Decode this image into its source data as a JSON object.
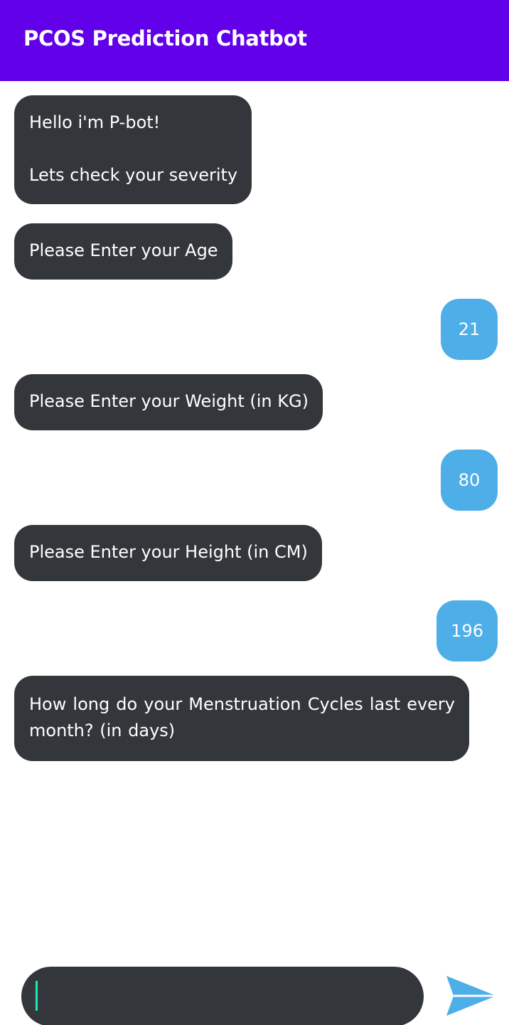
{
  "header": {
    "title": "PCOS Prediction Chatbot",
    "background": "#6200ea"
  },
  "colors": {
    "bot_bubble": "#33363a",
    "user_bubble": "#4eaee8",
    "caret": "#1de9b6",
    "send_icon": "#4eaee8"
  },
  "messages": [
    {
      "sender": "bot",
      "lines": [
        "Hello i'm P-bot!",
        "Lets check your severity"
      ]
    },
    {
      "sender": "bot",
      "text": "Please Enter your Age"
    },
    {
      "sender": "user",
      "text": "21"
    },
    {
      "sender": "bot",
      "text": "Please Enter your Weight (in KG)"
    },
    {
      "sender": "user",
      "text": "80"
    },
    {
      "sender": "bot",
      "text": "Please Enter your Height (in CM)"
    },
    {
      "sender": "user",
      "text": "196"
    },
    {
      "sender": "bot",
      "text": "How long do your Menstruation Cycles last every month? (in days)"
    }
  ],
  "composer": {
    "value": "",
    "send_icon": "send-arrow-icon"
  }
}
